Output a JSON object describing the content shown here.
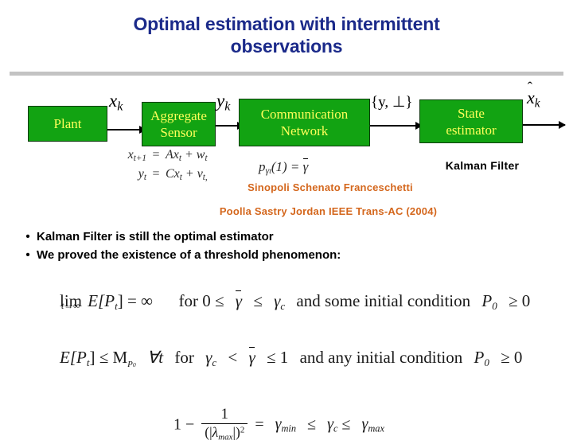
{
  "slide": {
    "title_lines": [
      "Optimal estimation with intermittent",
      "observations"
    ],
    "title_color": "#1b2a8a",
    "divider_color": "#c3c3c3"
  },
  "diagram": {
    "block_fill": "#12a312",
    "block_text_color": "#ffff5a",
    "blocks": [
      {
        "name": "plant",
        "lines": [
          "Plant"
        ]
      },
      {
        "name": "aggregate-sensor",
        "lines": [
          "Aggregate",
          "Sensor"
        ]
      },
      {
        "name": "communication-network",
        "lines": [
          "Communication",
          "Network"
        ]
      },
      {
        "name": "state-estimator",
        "lines": [
          "State",
          "estimator"
        ]
      }
    ],
    "signal_labels": {
      "plant_output": "x",
      "plant_output_sub": "k",
      "sensor_output": "y",
      "sensor_output_sub": "k",
      "network_output": "{y, ⊥}",
      "estimate": "x",
      "estimate_sub": "k",
      "estimate_hat": "^"
    },
    "plant_equations": [
      {
        "lhs_base": "x",
        "lhs_sub": "t+1",
        "eq": "=",
        "rhs": "Ax",
        "rhs_sub": "t",
        "rhs_tail": "+ w",
        "rhs_tail_sub": "t"
      },
      {
        "lhs_base": "y",
        "lhs_sub": "t",
        "eq": "=",
        "rhs": "Cx",
        "rhs_sub": "t",
        "rhs_tail": "+ v",
        "rhs_tail_sub": "t,"
      }
    ],
    "network_equation": {
      "p": "p",
      "p_sub": "γ",
      "p_sub2": "t",
      "arg": "(1) =",
      "gamma_bar": "γ"
    }
  },
  "annotations": {
    "kalman_filter": "Kalman Filter",
    "citation_line_1": "Sinopoli Schenato Franceschetti",
    "citation_line_2": "Poolla Sastry Jordan IEEE Trans-AC (2004)",
    "citation_color": "#d4671d"
  },
  "bullets": [
    {
      "marker": "•",
      "text": "Kalman Filter is still the optimal estimator"
    },
    {
      "marker": "•",
      "text": "We proved the existence of a threshold phenomenon:"
    }
  ],
  "math": {
    "line1": {
      "lim": "lim",
      "lim_sub": "t→∞",
      "expectation": "E[P",
      "expectation_sub": "t",
      "expectation_close": "] = ∞",
      "condition_pre": "for 0 ≤",
      "gamma_bar": "γ",
      "rel": "≤",
      "gamma_c": "γ",
      "gamma_c_sub": "c",
      "condition_post": "and some initial condition",
      "P0": "P",
      "P0_sub": "0",
      "P0_rel": "≥ 0"
    },
    "line2": {
      "expectation": "E[P",
      "expectation_sub": "t",
      "expectation_close": "] ≤ M",
      "M_sub": "P",
      "M_sub2": "0",
      "forall": "∀t",
      "for": "for",
      "gamma_c": "γ",
      "gamma_c_sub": "c",
      "rel1": "<",
      "gamma_bar": "γ",
      "rel2": "≤ 1",
      "condition_post": "and any initial condition",
      "P0": "P",
      "P0_sub": "0",
      "P0_rel": "≥ 0"
    },
    "line3": {
      "one_minus": "1 −",
      "numerator": "1",
      "den_open": "(|",
      "lambda": "λ",
      "lambda_sub": "max",
      "den_close": "|)",
      "den_pow": "2",
      "equals": "=",
      "gamma_min": "γ",
      "gamma_min_sub": "min",
      "rel1": "≤",
      "gamma_c": "γ",
      "gamma_c_sub": "c",
      "rel2": "≤",
      "gamma_max": "γ",
      "gamma_max_sub": "max"
    }
  }
}
